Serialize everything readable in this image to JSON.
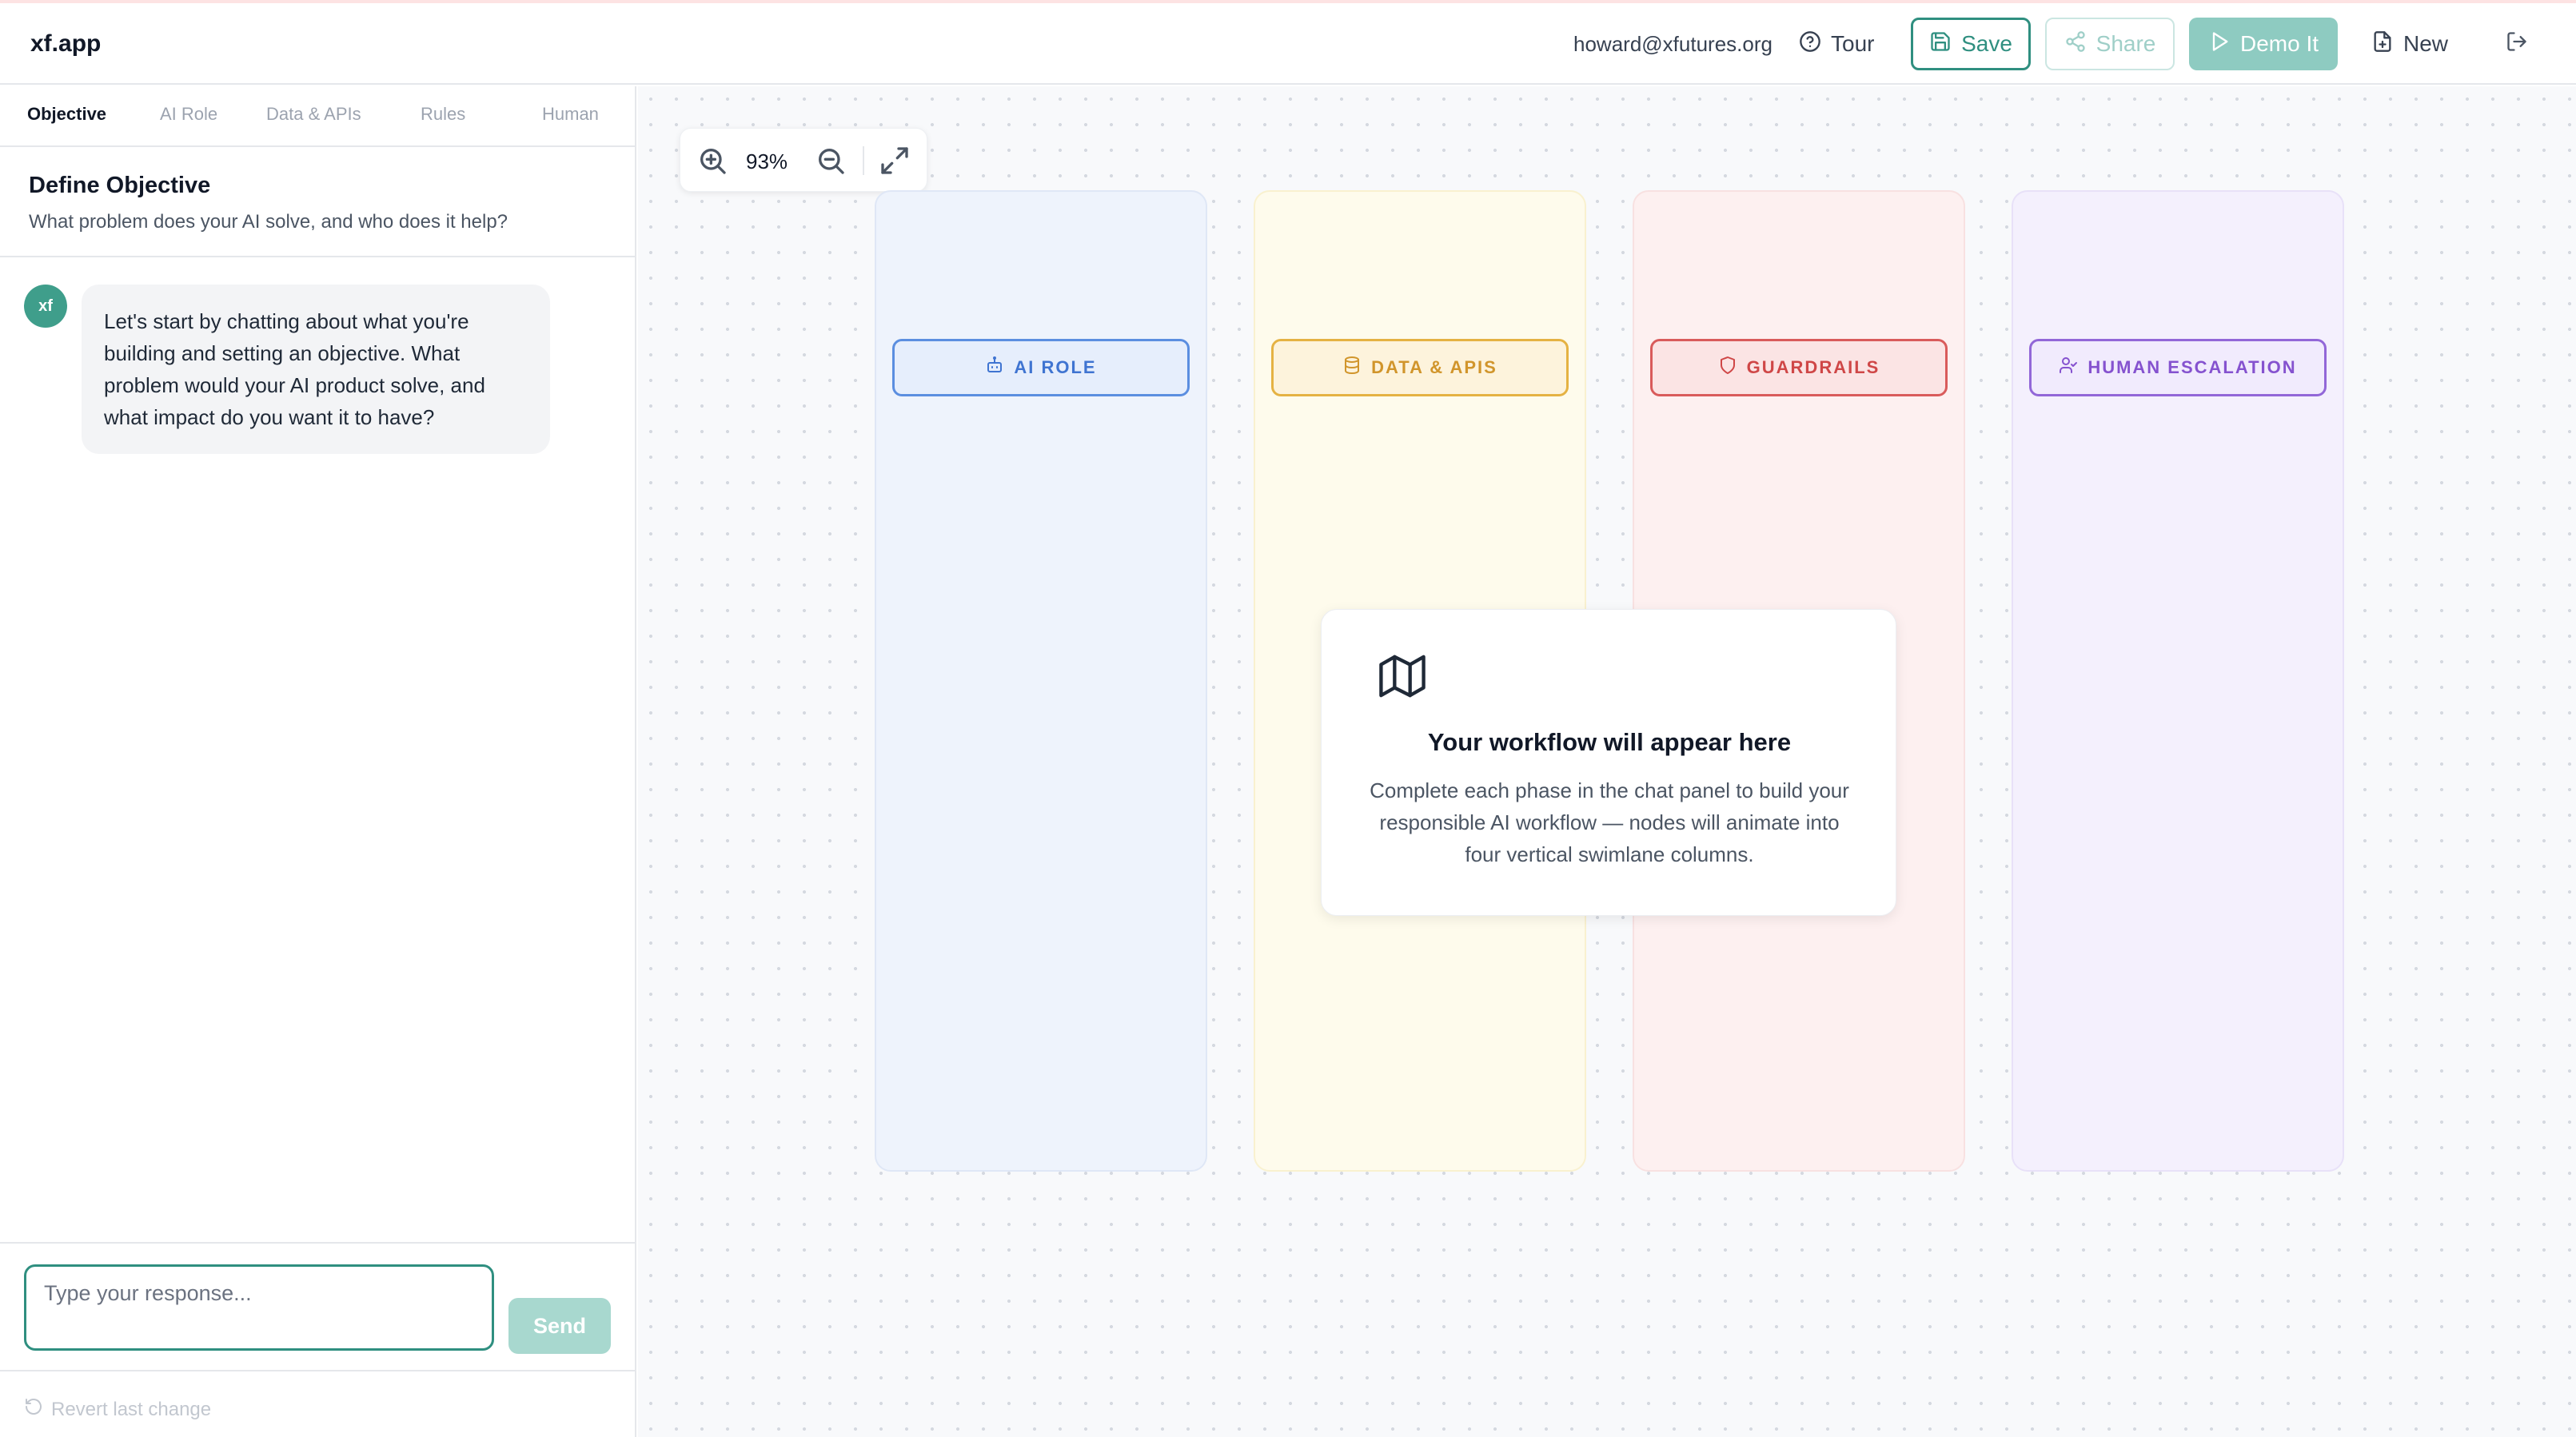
{
  "app": {
    "title": "xf.app"
  },
  "header": {
    "user_email": "howard@xfutures.org",
    "tour_label": "Tour",
    "save_label": "Save",
    "share_label": "Share",
    "demo_label": "Demo It",
    "new_label": "New"
  },
  "tabs": [
    {
      "label": "Objective",
      "active": true
    },
    {
      "label": "AI Role",
      "active": false
    },
    {
      "label": "Data & APIs",
      "active": false
    },
    {
      "label": "Rules",
      "active": false
    },
    {
      "label": "Human",
      "active": false
    }
  ],
  "objective": {
    "title": "Define Objective",
    "subtitle": "What problem does your AI solve, and who does it help?"
  },
  "chat": {
    "messages": [
      {
        "avatar": "xf",
        "text": "Let's start by chatting about what you're building and setting an objective. What problem would your AI product solve, and what impact do you want it to have?"
      }
    ],
    "input_placeholder": "Type your response...",
    "send_label": "Send",
    "revert_label": "Revert last change"
  },
  "canvas": {
    "zoom": "93%",
    "lanes": [
      {
        "label": "AI ROLE",
        "icon": "bot-icon",
        "color": "#3f74d1"
      },
      {
        "label": "DATA & APIS",
        "icon": "database-icon",
        "color": "#d1952b"
      },
      {
        "label": "GUARDRAILS",
        "icon": "shield-icon",
        "color": "#cf4747"
      },
      {
        "label": "HUMAN ESCALATION",
        "icon": "user-check-icon",
        "color": "#8552cf"
      }
    ],
    "empty_state": {
      "icon": "map-icon",
      "title": "Your workflow will appear here",
      "description": "Complete each phase in the chat panel to build your responsible AI workflow — nodes will animate into four vertical swimlane columns."
    }
  },
  "colors": {
    "accent": "#2f8f80",
    "avatar": "#3f9e8b"
  }
}
